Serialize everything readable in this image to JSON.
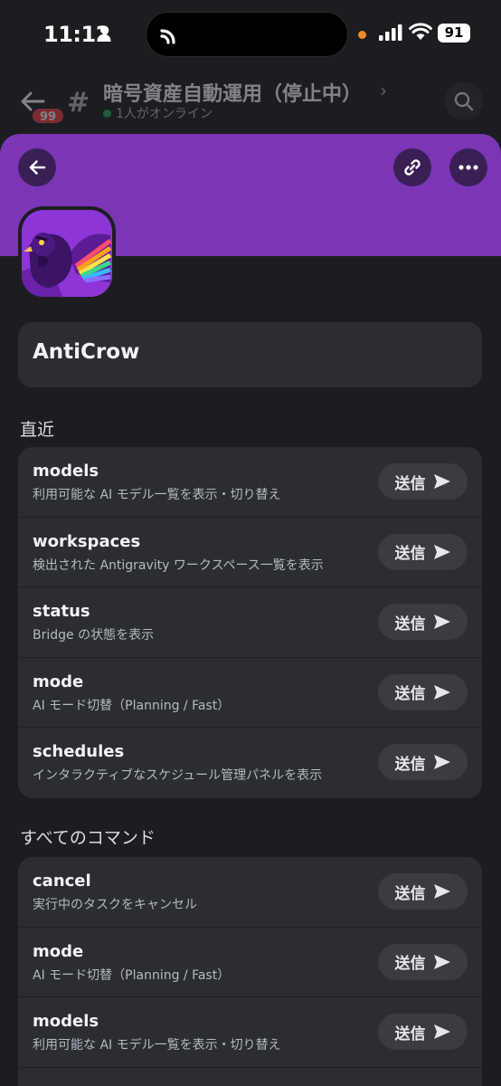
{
  "status_bar": {
    "time": "11:12",
    "battery": "91"
  },
  "channel_header": {
    "unread_count": "99",
    "channel_name": "暗号資産自動運用（停止中）",
    "online_status": "1人がオンライン"
  },
  "profile": {
    "name": "AntiCrow"
  },
  "sections": {
    "recent_title": "直近",
    "all_title": "すべてのコマンド"
  },
  "send_label": "送信",
  "recent_commands": [
    {
      "name": "models",
      "description": "利用可能な AI モデル一覧を表示・切り替え"
    },
    {
      "name": "workspaces",
      "description": "検出された Antigravity ワークスペース一覧を表示"
    },
    {
      "name": "status",
      "description": "Bridge の状態を表示"
    },
    {
      "name": "mode",
      "description": "AI モード切替（Planning / Fast）"
    },
    {
      "name": "schedules",
      "description": "インタラクティブなスケジュール管理パネルを表示"
    }
  ],
  "all_commands": [
    {
      "name": "cancel",
      "description": "実行中のタスクをキャンセル"
    },
    {
      "name": "mode",
      "description": "AI モード切替（Planning / Fast）"
    },
    {
      "name": "models",
      "description": "利用可能な AI モデル一覧を表示・切り替え"
    }
  ],
  "colors": {
    "banner": "#7b36b5",
    "background": "#1c1d21",
    "card": "#2b2d31",
    "online": "#23a55a",
    "badge": "#f23f43"
  }
}
